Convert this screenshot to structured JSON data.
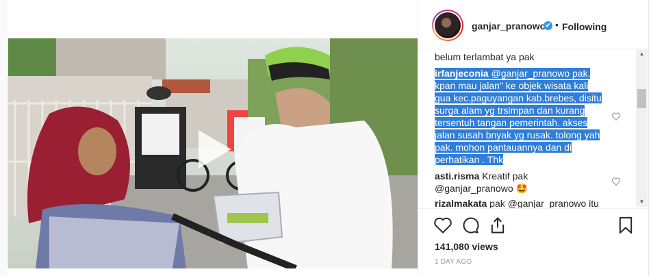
{
  "header": {
    "username": "ganjar_pranowo",
    "verified_mark": "✔",
    "separator": "•",
    "follow_status": "Following"
  },
  "comments": [
    {
      "text": "belum terlambat ya pak"
    },
    {
      "author": "irfanjeconia",
      "lines": [
        " @ganjar_pranowo pak.",
        "kpan mau jalan\" ke objek wisata kali",
        "gua kec.paguyangan kab.brebes, disitu",
        "surga alam yg trsimpan dan kurang",
        "tersentuh tangan pemerintah. akses",
        "jalan susah bnyak yg rusak. tolong yah",
        "pak. mohon pantauannya dan di",
        "perhatikan . Thk"
      ],
      "selected": true
    },
    {
      "author": "asti.risma",
      "text": " Kreatif pak",
      "line2": "@ganjar_pranowo 🤩"
    },
    {
      "author": "rizalmakata",
      "text": " pak @ganjar_pranowo itu"
    }
  ],
  "stats": {
    "views": "141,080 views",
    "date": "1 DAY AGO"
  },
  "icons": {
    "like": "heart-icon",
    "comment": "comment-icon",
    "share": "share-icon",
    "save": "bookmark-icon",
    "play": "play-icon",
    "comment_like": "heart-icon-small"
  },
  "colors": {
    "accent_verified": "#3897f0",
    "selection": "#2f7ed8",
    "text": "#262626",
    "muted": "#999999"
  }
}
